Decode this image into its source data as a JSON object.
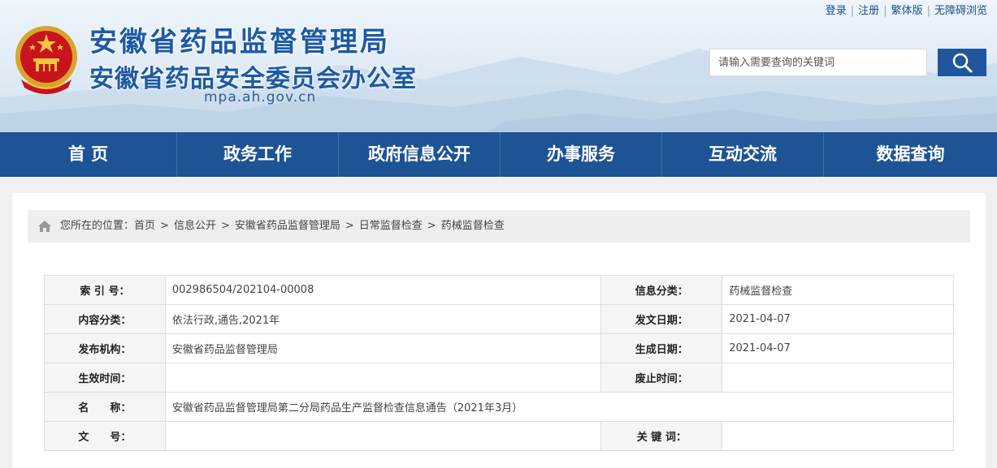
{
  "site": {
    "title_main": "安徽省药品监督管理局",
    "title_sub": "安徽省药品安全委员会办公室",
    "domain": "mpa.ah.gov.cn"
  },
  "toplinks": [
    "登录",
    "注册",
    "繁体版",
    "无障碍浏览"
  ],
  "search": {
    "placeholder": "请输入需要查询的关键词"
  },
  "nav": [
    "首 页",
    "政务工作",
    "政府信息公开",
    "办事服务",
    "互动交流",
    "数据查询"
  ],
  "breadcrumb": {
    "prefix": "您所在的位置：",
    "items": [
      "首页",
      "信息公开",
      "安徽省药品监督管理局",
      "日常监督检查",
      "药械监督检查"
    ]
  },
  "meta_table": [
    {
      "label1": "索 引 号：",
      "value1": "002986504/202104-00008",
      "label2": "信息分类：",
      "value2": "药械监督检查"
    },
    {
      "label1": "内容分类：",
      "value1": "依法行政,通告,2021年",
      "label2": "发文日期：",
      "value2": "2021-04-07"
    },
    {
      "label1": "发布机构：",
      "value1": "安徽省药品监督管理局",
      "label2": "生成日期：",
      "value2": "2021-04-07"
    },
    {
      "label1": "生效时间：",
      "value1": "",
      "label2": "废止时间：",
      "value2": ""
    },
    {
      "label1": "名　　称：",
      "value1": "安徽省药品监督管理局第二分局药品生产监督检查信息通告（2021年3月）",
      "label2": null,
      "value2": null
    },
    {
      "label1": "文　　号：",
      "value1": "",
      "label2": "关 键 词：",
      "value2": ""
    }
  ],
  "colors": {
    "brand_blue": "#1e5395",
    "title_blue": "#1d5aa3",
    "search_button": "#20569c"
  }
}
